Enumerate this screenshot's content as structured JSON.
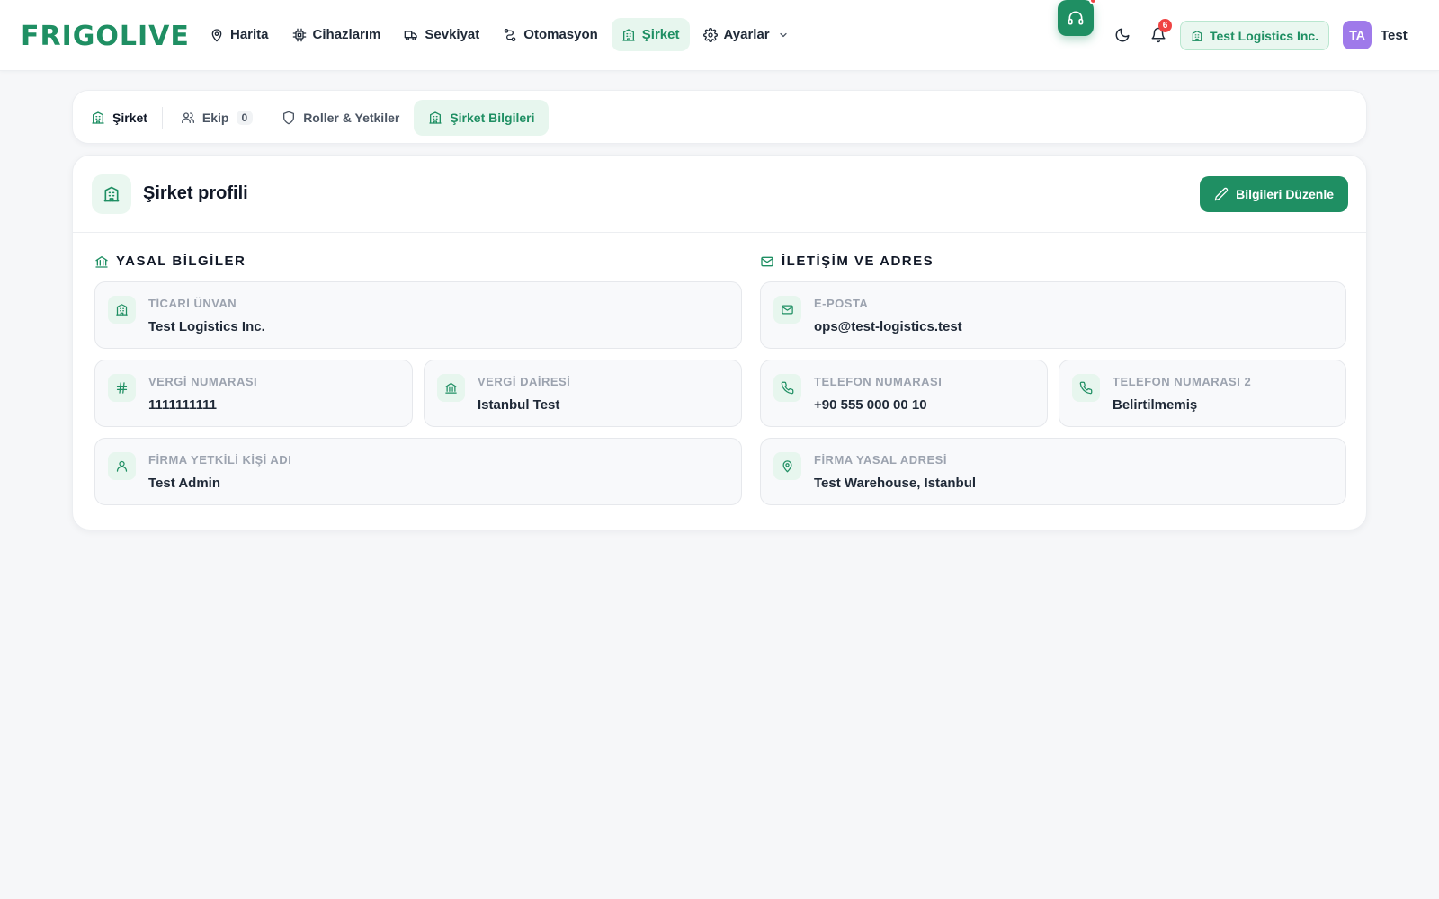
{
  "brand": {
    "logo_text": "FRIGOLIVE",
    "accent": "#1f8f63"
  },
  "nav": {
    "items": [
      {
        "label": "Harita",
        "icon": "map-pin-icon"
      },
      {
        "label": "Cihazlarım",
        "icon": "chip-icon"
      },
      {
        "label": "Sevkiyat",
        "icon": "truck-icon"
      },
      {
        "label": "Otomasyon",
        "icon": "route-icon"
      },
      {
        "label": "Şirket",
        "icon": "building-icon",
        "active": true
      },
      {
        "label": "Ayarlar",
        "icon": "gear-icon"
      }
    ]
  },
  "header": {
    "notification_count": "6",
    "company_chip": "Test Logistics Inc.",
    "avatar_initials": "TA",
    "user_name": "Test"
  },
  "subtabs": {
    "home": "Şirket",
    "team": "Ekip",
    "team_count": "0",
    "roles": "Roller & Yetkiler",
    "info": "Şirket Bilgileri"
  },
  "profile": {
    "title": "Şirket profili",
    "edit_button": "Bilgileri Düzenle",
    "legal_section": "YASAL BİLGİLER",
    "contact_section": "İLETİŞİM VE ADRES",
    "fields": {
      "trade_name": {
        "label": "TİCARİ ÜNVAN",
        "value": "Test Logistics Inc."
      },
      "tax_number": {
        "label": "VERGİ NUMARASI",
        "value": "1111111111"
      },
      "tax_office": {
        "label": "VERGİ DAİRESİ",
        "value": "Istanbul Test"
      },
      "contact_person": {
        "label": "FİRMA YETKİLİ KİŞİ ADI",
        "value": "Test Admin"
      },
      "email": {
        "label": "E-POSTA",
        "value": "ops@test-logistics.test"
      },
      "phone": {
        "label": "TELEFON NUMARASI",
        "value": "+90 555 000 00 10"
      },
      "phone2": {
        "label": "TELEFON NUMARASI 2",
        "value": "Belirtilmemiş"
      },
      "address": {
        "label": "FİRMA YASAL ADRESİ",
        "value": "Test Warehouse, Istanbul"
      }
    }
  }
}
